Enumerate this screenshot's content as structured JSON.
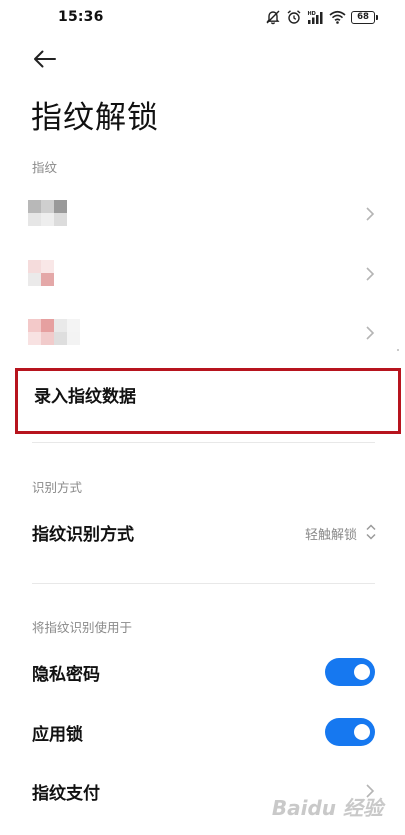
{
  "status_bar": {
    "time": "15:36",
    "battery": "68"
  },
  "page": {
    "title": "指纹解锁"
  },
  "fingerprints": {
    "header": "指纹",
    "items": [
      {
        "colors": [
          "#b8b8b8",
          "#cfcfcf",
          "#9a9a9a",
          "#ffffff",
          "#e6e6e6",
          "#eeeeee",
          "#dcdcdc",
          "#ffffff"
        ]
      },
      {
        "colors": [
          "#f5dcdc",
          "#f9e7e7",
          "#ffffff",
          "#ffffff",
          "#ebeaea",
          "#e4a8a8",
          "#ffffff",
          "#ffffff"
        ]
      },
      {
        "colors": [
          "#f3c9c9",
          "#e6a0a0",
          "#e9e9e9",
          "#f4f4f4",
          "#f8e2e2",
          "#f1cbcb",
          "#dedede",
          "#f3f3f3"
        ]
      }
    ],
    "enroll_label": "录入指纹数据"
  },
  "recognition": {
    "header": "识别方式",
    "label": "指纹识别方式",
    "value": "轻触解锁"
  },
  "usage": {
    "header": "将指纹识别使用于",
    "items": [
      {
        "label": "隐私密码",
        "enabled": true
      },
      {
        "label": "应用锁",
        "enabled": true
      },
      {
        "label": "指纹支付"
      }
    ]
  },
  "watermark": "Baidu 经验",
  "colors": {
    "accent": "#1678f0",
    "highlight_border": "#b7141e",
    "secondary_text": "#8a8a8a"
  }
}
